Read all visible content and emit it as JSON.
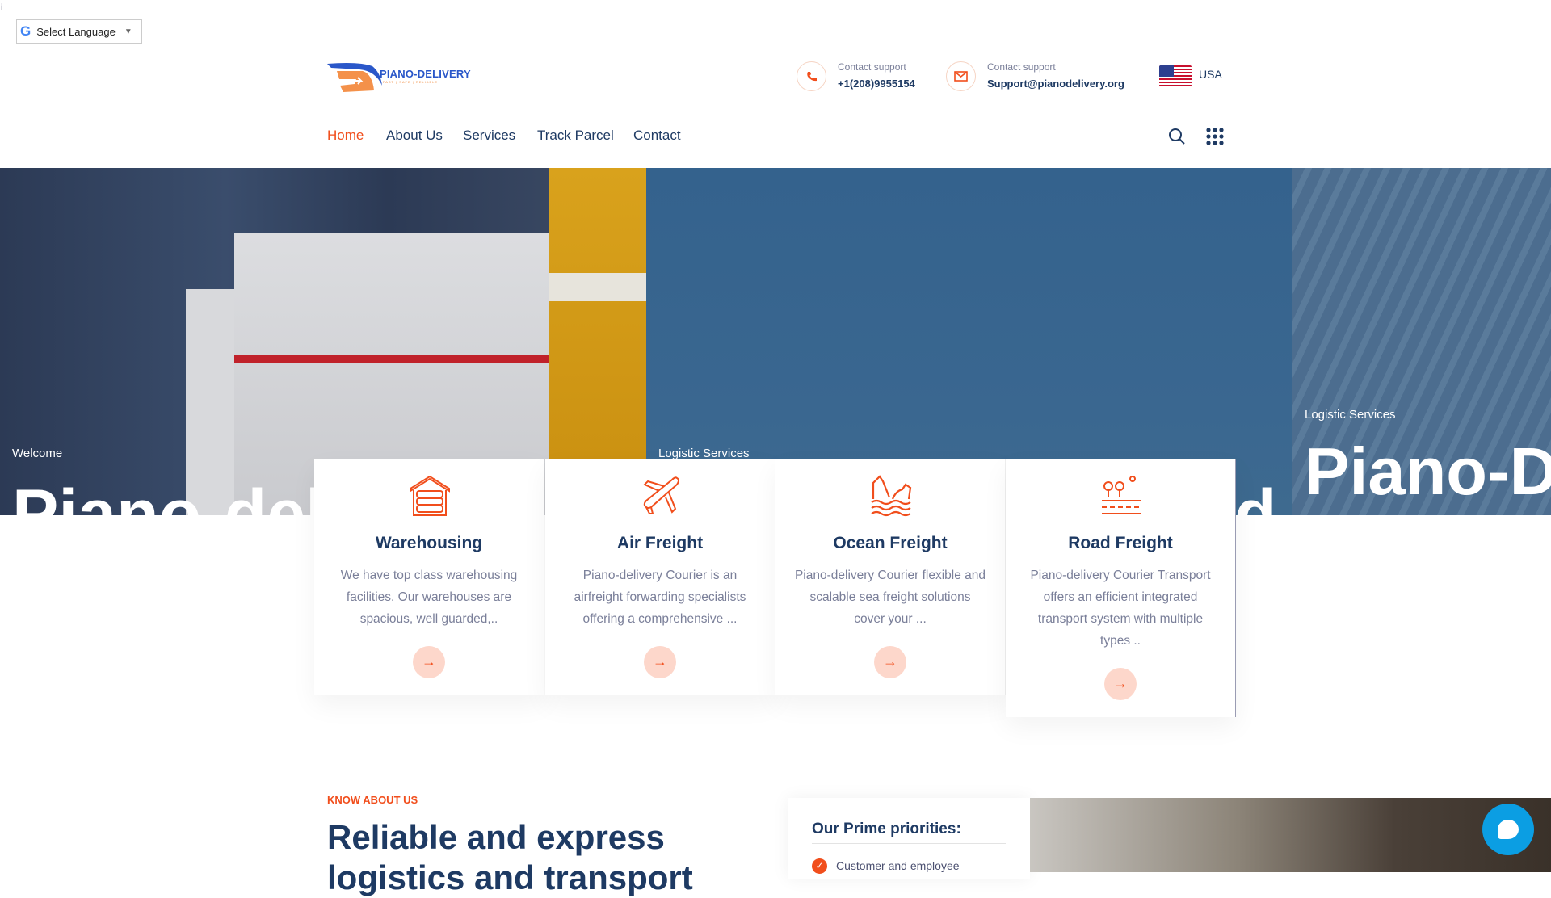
{
  "top": {
    "cursor_glyph": "i",
    "language_label": "Select Language",
    "language_arrow": "▼"
  },
  "logo": {
    "name": "PIANO-DELIVERY",
    "tagline": "FAST | SAFE | RELIABLE"
  },
  "contacts": [
    {
      "label": "Contact support",
      "value": "+1(208)9955154",
      "icon": "phone-icon"
    },
    {
      "label": "Contact support",
      "value": "Support@pianodelivery.org",
      "icon": "mail-icon"
    }
  ],
  "region": "USA",
  "nav": [
    {
      "label": "Home",
      "active": true
    },
    {
      "label": "About Us"
    },
    {
      "label": "Services"
    },
    {
      "label": "Track Parcel"
    },
    {
      "label": "Contact"
    }
  ],
  "hero": {
    "slides": [
      {
        "small": "Welcome",
        "big": "Piano-deli"
      },
      {
        "small": "Logistic Services",
        "big": "d"
      },
      {
        "small": "Logistic Services",
        "big": "Piano-D"
      }
    ]
  },
  "services": [
    {
      "title": "Warehousing",
      "desc": "We have top class warehousing facilities. Our warehouses are spacious, well guarded,..",
      "arrow": "→"
    },
    {
      "title": "Air Freight",
      "desc": "Piano-delivery Courier is an airfreight forwarding specialists offering a comprehensive ...",
      "arrow": "→"
    },
    {
      "title": "Ocean Freight",
      "desc": "Piano-delivery Courier flexible and scalable sea freight solutions cover your ...",
      "arrow": "→"
    },
    {
      "title": "Road Freight",
      "desc": "Piano-delivery Courier Transport offers an efficient integrated transport system with multiple types ..",
      "arrow": "→"
    }
  ],
  "about": {
    "eyebrow": "KNOW ABOUT US",
    "heading": "Reliable and express logistics and transport",
    "priorities_title": "Our Prime priorities:",
    "priorities": [
      "Customer and employee"
    ],
    "check": "✓"
  },
  "colors": {
    "accent": "#f14e1c",
    "navy": "#1e3a63",
    "chat": "#0b9ee3"
  }
}
